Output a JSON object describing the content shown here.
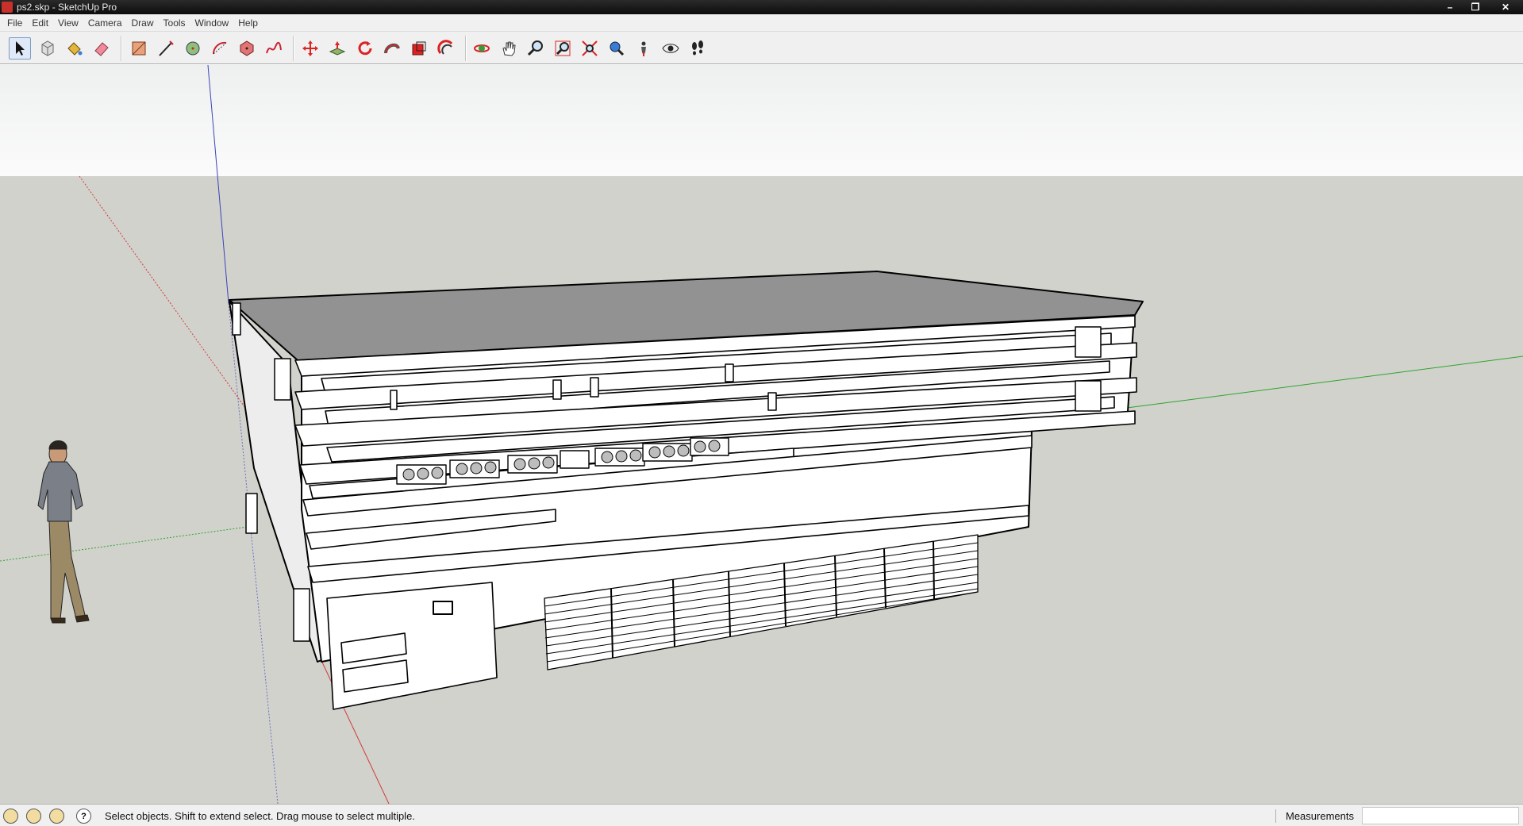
{
  "window": {
    "title": "ps2.skp - SketchUp Pro",
    "controls": {
      "minimize": "–",
      "restore": "❐",
      "close": "✕"
    }
  },
  "menu": {
    "items": [
      "File",
      "Edit",
      "View",
      "Camera",
      "Draw",
      "Tools",
      "Window",
      "Help"
    ]
  },
  "toolbar": {
    "tools": [
      {
        "name": "select-tool-icon",
        "active": true
      },
      {
        "name": "make-component-icon"
      },
      {
        "name": "paint-bucket-icon"
      },
      {
        "name": "eraser-icon"
      },
      {
        "name": "rectangle-icon"
      },
      {
        "name": "line-icon"
      },
      {
        "name": "circle-icon"
      },
      {
        "name": "arc-icon"
      },
      {
        "name": "polygon-icon"
      },
      {
        "name": "freehand-icon"
      },
      {
        "name": "move-icon"
      },
      {
        "name": "push-pull-icon"
      },
      {
        "name": "rotate-icon"
      },
      {
        "name": "follow-me-icon"
      },
      {
        "name": "scale-icon"
      },
      {
        "name": "offset-icon"
      },
      {
        "name": "orbit-icon"
      },
      {
        "name": "pan-icon"
      },
      {
        "name": "zoom-icon"
      },
      {
        "name": "zoom-window-icon"
      },
      {
        "name": "zoom-extents-icon"
      },
      {
        "name": "previous-view-icon"
      },
      {
        "name": "position-camera-icon"
      },
      {
        "name": "look-around-icon"
      },
      {
        "name": "walk-icon"
      }
    ]
  },
  "colors": {
    "sky": "#f7f8f8",
    "ground": "#d1d2cc",
    "roof": "#929292",
    "red_axis": "#d23a3a",
    "green_axis": "#2fa42f",
    "blue_axis": "#3b43b8"
  },
  "status": {
    "message": "Select objects. Shift to extend select. Drag mouse to select multiple.",
    "icons": [
      "geo-location-icon",
      "credits-icon",
      "user-icon",
      "help-icon"
    ],
    "help_glyph": "?"
  },
  "measurements": {
    "label": "Measurements",
    "value": ""
  }
}
